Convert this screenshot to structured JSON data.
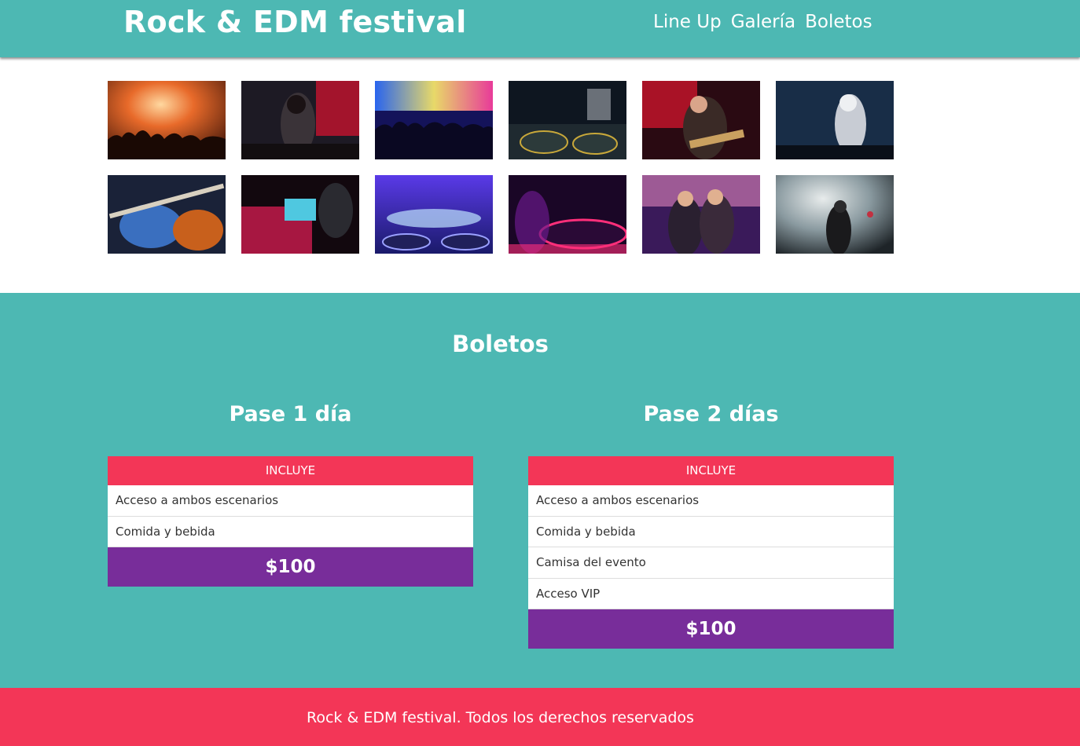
{
  "header": {
    "title": "Rock & EDM festival",
    "nav": [
      "Line Up",
      "Galería",
      "Boletos"
    ]
  },
  "tickets": {
    "title": "Boletos",
    "plans": [
      {
        "name": "Pase 1 día",
        "includes_label": "INCLUYE",
        "items": [
          "Acceso a ambos escenarios",
          "Comida y bebida"
        ],
        "price": "$100"
      },
      {
        "name": "Pase 2 días",
        "includes_label": "INCLUYE",
        "items": [
          "Acceso a ambos escenarios",
          "Comida y bebida",
          "Camisa del evento",
          "Acceso VIP"
        ],
        "price": "$100"
      }
    ]
  },
  "footer": {
    "text": "Rock & EDM festival. Todos los derechos reservados"
  },
  "colors": {
    "teal": "#4db8b3",
    "pink": "#f33657",
    "purple": "#782d9a"
  }
}
